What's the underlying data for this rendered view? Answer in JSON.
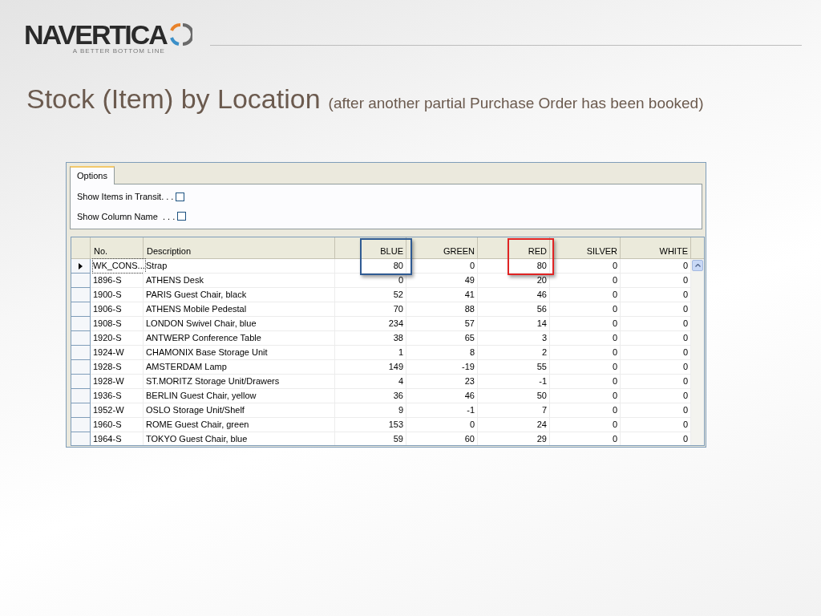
{
  "logo": {
    "name": "NAVERTICA",
    "tagline": "A BETTER BOTTOM LINE"
  },
  "title": {
    "main": "Stock (Item) by Location",
    "note": "(after another partial Purchase Order has been booked)"
  },
  "window": {
    "tabs": [
      {
        "label": "Options",
        "selected": true
      }
    ],
    "options": [
      {
        "label": "Show Items in Transit. . .",
        "checked": false
      },
      {
        "label": "Show Column Name  . . .",
        "checked": false
      }
    ],
    "table": {
      "columns": [
        {
          "label": "No.",
          "highlighted": false
        },
        {
          "label": "Description",
          "highlighted": false
        },
        {
          "label": "BLUE",
          "highlighted": true,
          "color": "#2f5b93"
        },
        {
          "label": "GREEN",
          "highlighted": false
        },
        {
          "label": "RED",
          "highlighted": true,
          "color": "#e02424"
        },
        {
          "label": "SILVER",
          "highlighted": false
        },
        {
          "label": "WHITE",
          "highlighted": false
        }
      ],
      "rows": [
        {
          "selected": true,
          "cells": [
            "WK_CONS...",
            "Strap",
            "80",
            "0",
            "80",
            "0",
            "0"
          ]
        },
        {
          "selected": false,
          "cells": [
            "1896-S",
            "ATHENS Desk",
            "0",
            "49",
            "20",
            "0",
            "0"
          ]
        },
        {
          "selected": false,
          "cells": [
            "1900-S",
            "PARIS Guest Chair, black",
            "52",
            "41",
            "46",
            "0",
            "0"
          ]
        },
        {
          "selected": false,
          "cells": [
            "1906-S",
            "ATHENS Mobile Pedestal",
            "70",
            "88",
            "56",
            "0",
            "0"
          ]
        },
        {
          "selected": false,
          "cells": [
            "1908-S",
            "LONDON Swivel Chair, blue",
            "234",
            "57",
            "14",
            "0",
            "0"
          ]
        },
        {
          "selected": false,
          "cells": [
            "1920-S",
            "ANTWERP Conference Table",
            "38",
            "65",
            "3",
            "0",
            "0"
          ]
        },
        {
          "selected": false,
          "cells": [
            "1924-W",
            "CHAMONIX Base Storage Unit",
            "1",
            "8",
            "2",
            "0",
            "0"
          ]
        },
        {
          "selected": false,
          "cells": [
            "1928-S",
            "AMSTERDAM Lamp",
            "149",
            "-19",
            "55",
            "0",
            "0"
          ]
        },
        {
          "selected": false,
          "cells": [
            "1928-W",
            "ST.MORITZ Storage Unit/Drawers",
            "4",
            "23",
            "-1",
            "0",
            "0"
          ]
        },
        {
          "selected": false,
          "cells": [
            "1936-S",
            "BERLIN Guest Chair, yellow",
            "36",
            "46",
            "50",
            "0",
            "0"
          ]
        },
        {
          "selected": false,
          "cells": [
            "1952-W",
            "OSLO Storage Unit/Shelf",
            "9",
            "-1",
            "7",
            "0",
            "0"
          ]
        },
        {
          "selected": false,
          "cells": [
            "1960-S",
            "ROME Guest Chair, green",
            "153",
            "0",
            "24",
            "0",
            "0"
          ]
        },
        {
          "selected": false,
          "cells": [
            "1964-S",
            "TOKYO Guest Chair, blue",
            "59",
            "60",
            "29",
            "0",
            "0"
          ]
        }
      ]
    }
  }
}
